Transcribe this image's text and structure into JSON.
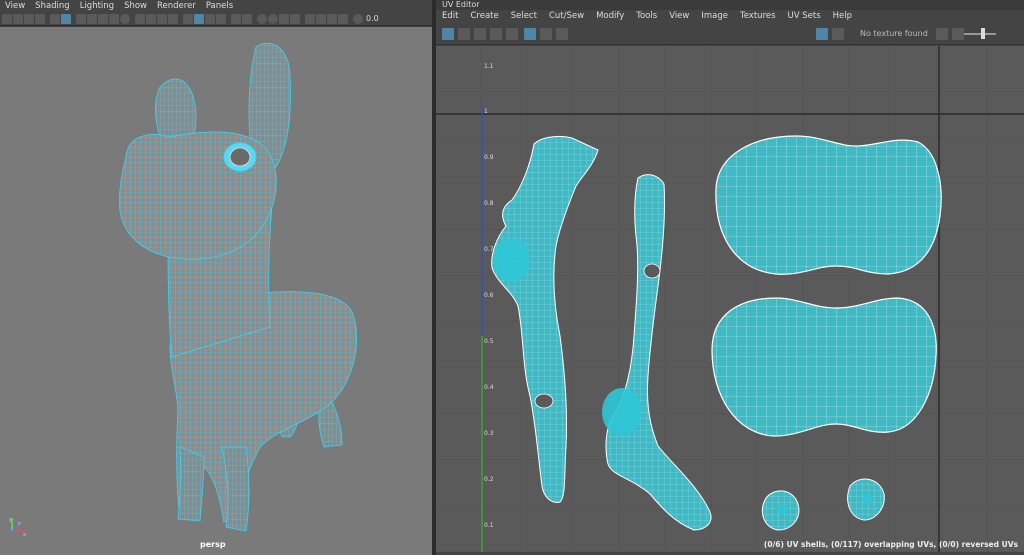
{
  "viewport": {
    "menu": [
      "View",
      "Shading",
      "Lighting",
      "Show",
      "Renderer",
      "Panels"
    ],
    "toolbar_value": "0.0",
    "camera_label": "persp",
    "axis_labels": {
      "x": "x",
      "y": "y",
      "z": "z"
    }
  },
  "uv_editor": {
    "title": "UV Editor",
    "menu": [
      "Edit",
      "Create",
      "Select",
      "Cut/Sew",
      "Modify",
      "Tools",
      "View",
      "Image",
      "Textures",
      "UV Sets",
      "Help"
    ],
    "texture_label": "No texture found",
    "axis_ticks": [
      "1.1",
      "1",
      "0.9",
      "0.8",
      "0.7",
      "0.6",
      "0.5",
      "0.4",
      "0.3",
      "0.2",
      "0.1"
    ],
    "status": "(0/6) UV shells, (0/117) overlapping UVs, (0/0) reversed UVs"
  },
  "colors": {
    "wire": "#37d6f5",
    "uv_fill": "#3fb9c4",
    "uv_outline": "#ffffff",
    "highlight_button": "#5285a6"
  }
}
